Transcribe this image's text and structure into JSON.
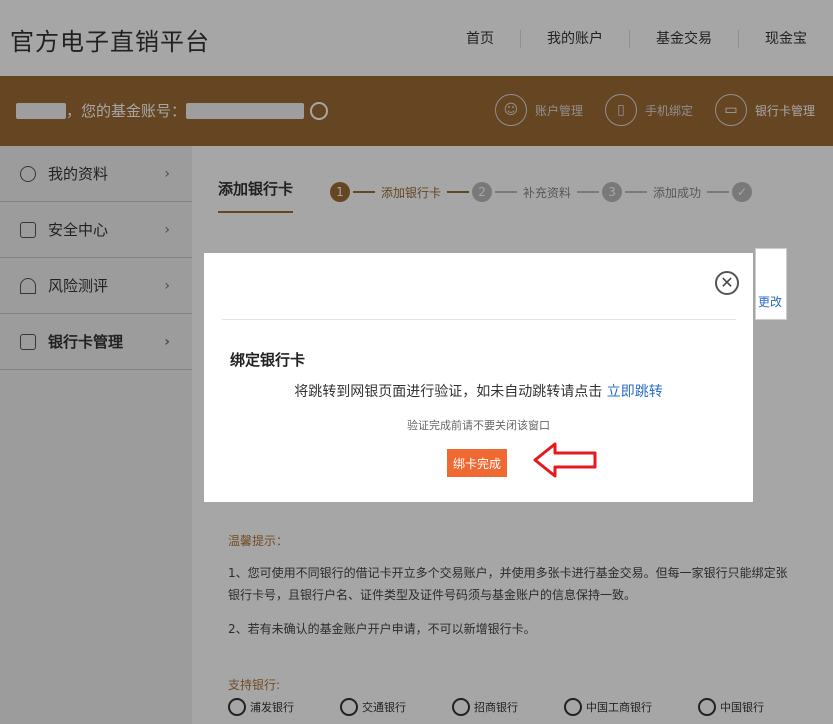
{
  "header": {
    "title": "官方电子直销平台",
    "nav": [
      "首页",
      "我的账户",
      "基金交易",
      "现金宝"
    ]
  },
  "banner": {
    "account_label": "，您的基金账号：",
    "items": [
      {
        "label": "账户管理",
        "icon": "user-icon"
      },
      {
        "label": "手机绑定",
        "icon": "phone-icon"
      },
      {
        "label": "银行卡管理",
        "icon": "card-icon"
      }
    ]
  },
  "sidebar": {
    "items": [
      {
        "label": "我的资料",
        "icon": "user-icon"
      },
      {
        "label": "安全中心",
        "icon": "shield-icon"
      },
      {
        "label": "风险测评",
        "icon": "umbrella-icon"
      },
      {
        "label": "银行卡管理",
        "icon": "card-icon"
      }
    ]
  },
  "main": {
    "title": "添加银行卡",
    "steps": [
      {
        "num": "1",
        "label": "添加银行卡"
      },
      {
        "num": "2",
        "label": "补充资料"
      },
      {
        "num": "3",
        "label": "添加成功"
      }
    ],
    "side_link": "更改",
    "tips_title": "温馨提示：",
    "tips": [
      "1、您可使用不同银行的借记卡开立多个交易账户，并使用多张卡进行基金交易。但每一家银行只能绑定张银行卡号，且银行户名、证件类型及证件号码须与基金账户的信息保持一致。",
      "2、若有未确认的基金账户开户申请，不可以新增银行卡。"
    ],
    "banks_title": "支持银行:",
    "banks": [
      "浦发银行",
      "交通银行",
      "招商银行",
      "中国工商银行",
      "中国银行"
    ]
  },
  "modal": {
    "close": "✕",
    "title": "绑定银行卡",
    "message": "将跳转到网银页面进行验证，如未自动跳转请点击",
    "link": "立即跳转",
    "note": "验证完成前请不要关闭该窗口",
    "button": "绑卡完成"
  },
  "colors": {
    "brand": "#9d6a36",
    "button": "#ef6a32",
    "link": "#2a6cc6",
    "annotation": "#e8191c"
  }
}
